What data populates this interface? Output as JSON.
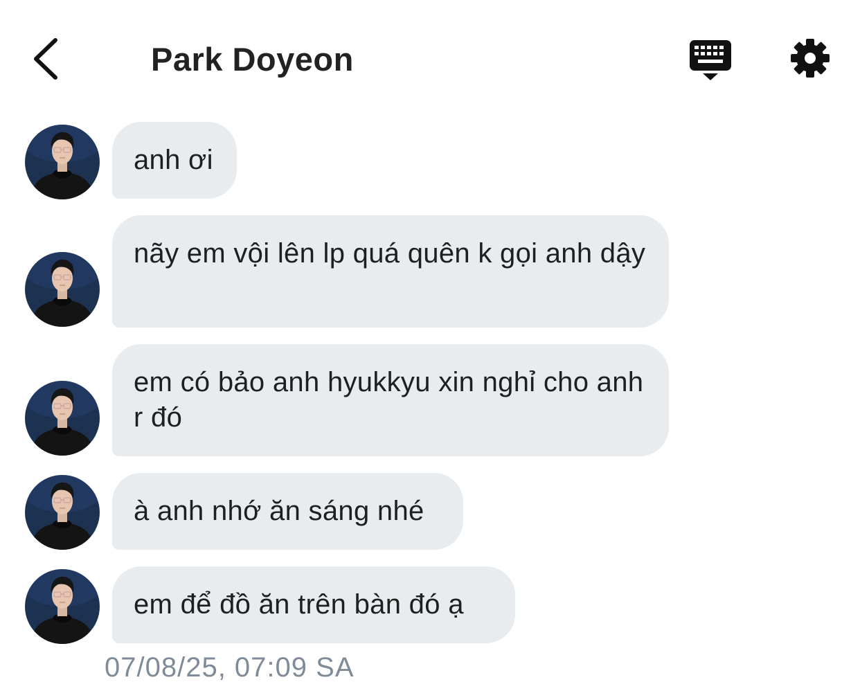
{
  "header": {
    "title": "Park Doyeon",
    "back_icon": "chevron-left-icon",
    "keyboard_icon": "keyboard-icon",
    "settings_icon": "gear-icon"
  },
  "messages": [
    {
      "text": "anh ơi"
    },
    {
      "text": "nãy em vội lên lp quá quên k gọi anh dậy"
    },
    {
      "text": "em có bảo anh hyukkyu xin nghỉ cho anh r đó"
    },
    {
      "text": "à anh nhớ ăn sáng nhé"
    },
    {
      "text": "em để đồ ăn trên bàn đó ạ"
    }
  ],
  "timestamp": "07/08/25, 07:09 SA",
  "colors": {
    "bubble": "#e8ecef",
    "timestamp": "#7f8b99",
    "icon": "#111111"
  }
}
